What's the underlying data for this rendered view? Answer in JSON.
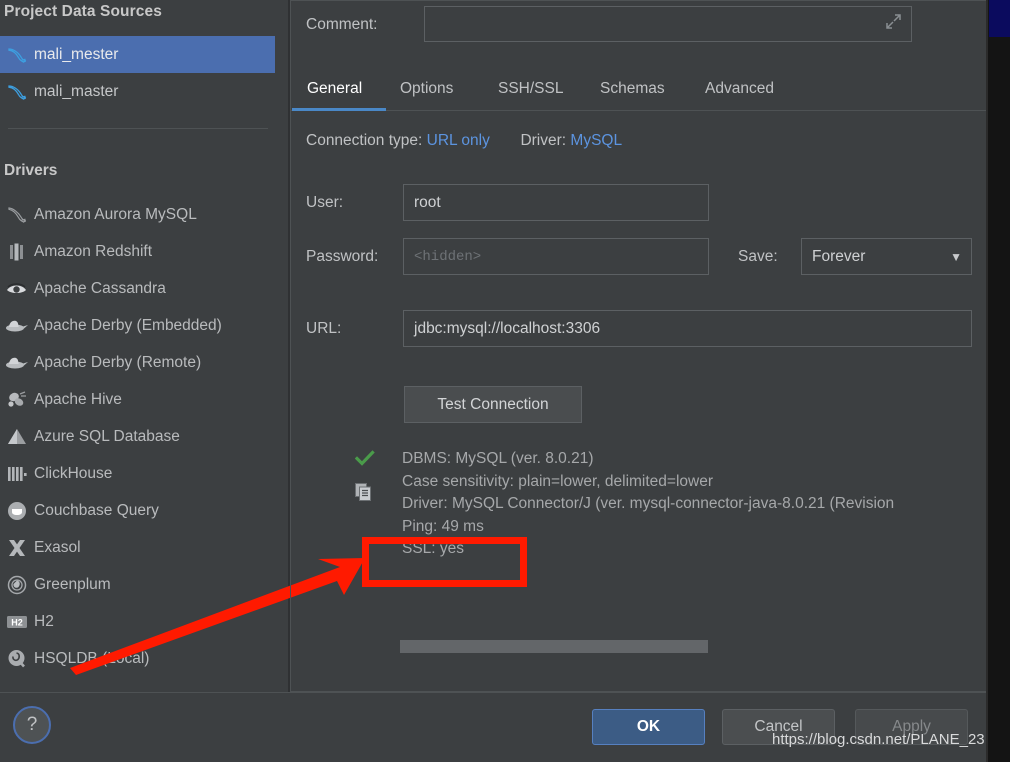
{
  "sidebar": {
    "project_title": "Project Data Sources",
    "data_sources": [
      {
        "label": "mali_mester",
        "icon": "mysql-dolphin-icon",
        "selected": true
      },
      {
        "label": "mali_master",
        "icon": "mysql-dolphin-icon",
        "selected": false
      }
    ],
    "drivers_title": "Drivers",
    "drivers": [
      {
        "label": "Amazon Aurora MySQL",
        "icon": "aurora-mysql-icon"
      },
      {
        "label": "Amazon Redshift",
        "icon": "redshift-icon"
      },
      {
        "label": "Apache Cassandra",
        "icon": "cassandra-eye-icon"
      },
      {
        "label": "Apache Derby (Embedded)",
        "icon": "derby-hat-icon"
      },
      {
        "label": "Apache Derby (Remote)",
        "icon": "derby-hat-icon"
      },
      {
        "label": "Apache Hive",
        "icon": "hive-bee-icon"
      },
      {
        "label": "Azure SQL Database",
        "icon": "azure-icon"
      },
      {
        "label": "ClickHouse",
        "icon": "clickhouse-icon"
      },
      {
        "label": "Couchbase Query",
        "icon": "couchbase-icon"
      },
      {
        "label": "Exasol",
        "icon": "exasol-x-icon"
      },
      {
        "label": "Greenplum",
        "icon": "greenplum-icon"
      },
      {
        "label": "H2",
        "icon": "h2-icon"
      },
      {
        "label": "HSQLDB (Local)",
        "icon": "hsqldb-icon"
      }
    ]
  },
  "panel": {
    "comment": {
      "label": "Comment:",
      "value": "",
      "placeholder": "",
      "expand_icon": "expand-arrows-icon"
    },
    "tabs": [
      {
        "label": "General",
        "active": true
      },
      {
        "label": "Options",
        "active": false
      },
      {
        "label": "SSH/SSL",
        "active": false
      },
      {
        "label": "Schemas",
        "active": false
      },
      {
        "label": "Advanced",
        "active": false
      }
    ],
    "connection": {
      "type_label": "Connection type:",
      "type_value": "URL only",
      "driver_label": "Driver:",
      "driver_value": "MySQL"
    },
    "fields": {
      "user_label": "User:",
      "user_value": "root",
      "password_label": "Password:",
      "password_placeholder": "<hidden>",
      "password_value": "",
      "save_label": "Save:",
      "save_value": "Forever",
      "url_label": "URL:",
      "url_value": "jdbc:mysql://localhost:3306"
    },
    "test_button": "Test Connection",
    "results": {
      "status_icon": "green-check-icon",
      "copy_icon": "copy-icon",
      "lines": [
        "DBMS: MySQL (ver. 8.0.21)",
        "Case sensitivity: plain=lower, delimited=lower",
        "Driver: MySQL Connector/J (ver. mysql-connector-java-8.0.21 (Revision",
        "Ping: 49 ms",
        "SSL: yes"
      ]
    }
  },
  "footer": {
    "help_label": "?",
    "ok_label": "OK",
    "cancel_label": "Cancel",
    "apply_label": "Apply"
  },
  "watermark": "https://blog.csdn.net/PLANE_23",
  "colors": {
    "background": "#3c3f41",
    "selection_blue": "#4b6eaf",
    "link_blue": "#5c94e0",
    "tab_accent": "#4a88c7",
    "ok_button": "#3c5c85",
    "annotation_red": "#ff1a00",
    "success_green": "#4a9b4a",
    "navy_block": "#0b0b5e"
  }
}
